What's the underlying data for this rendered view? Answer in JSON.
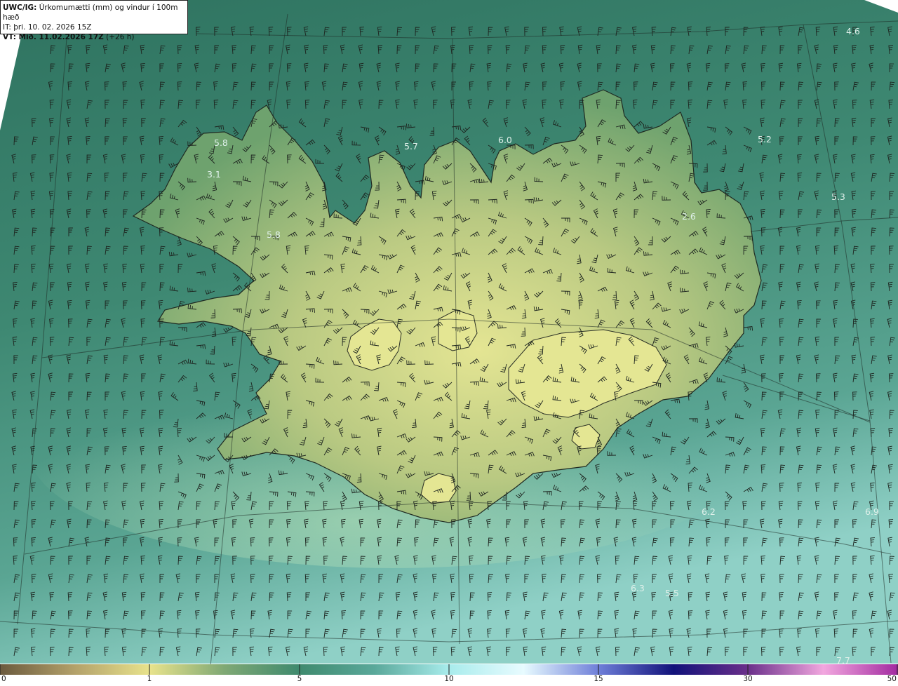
{
  "header": {
    "title_bold": "UWC/IG:",
    "title_rest": " Úrkomumætti (mm) og vindur í 100m hæð",
    "it_prefix": "IT:",
    "it_value": " þri. 10. 02. 2026 15Z",
    "vt_bold": "VT: Mið. 11.02.2026 17Z",
    "vt_rest": " (+26 h)"
  },
  "point_labels": [
    {
      "id": "pl-1",
      "text": "4.6"
    },
    {
      "id": "pl-2",
      "text": "5.8"
    },
    {
      "id": "pl-3",
      "text": "5.7"
    },
    {
      "id": "pl-4",
      "text": "6.0"
    },
    {
      "id": "pl-5",
      "text": "5.2"
    },
    {
      "id": "pl-6",
      "text": "3.1"
    },
    {
      "id": "pl-7",
      "text": "5.3"
    },
    {
      "id": "pl-8",
      "text": "2.6"
    },
    {
      "id": "pl-9",
      "text": "5.8"
    },
    {
      "id": "pl-10",
      "text": "6.2"
    },
    {
      "id": "pl-11",
      "text": "6.9"
    },
    {
      "id": "pl-12",
      "text": "6.3"
    },
    {
      "id": "pl-13",
      "text": "5.5"
    },
    {
      "id": "pl-14",
      "text": "7.7"
    }
  ],
  "colorbar": {
    "ticks": [
      "0",
      "1",
      "5",
      "10",
      "15",
      "30",
      "50"
    ],
    "colors": [
      "#6b5a3e",
      "#b3a16a",
      "#e8e38c",
      "#7fa874",
      "#3f8a6e",
      "#5aa89a",
      "#a8ecec",
      "#e8fbff",
      "#6e7ed8",
      "#12127a",
      "#6a2f8a",
      "#f2a7df",
      "#a22aa0"
    ]
  },
  "colors": {
    "sea_dark": "#2d6f5f",
    "sea_mid": "#3f8a78",
    "sea_light": "#7ec4b6",
    "land_low": "#5f9a6a",
    "land_high": "#dde08c"
  }
}
